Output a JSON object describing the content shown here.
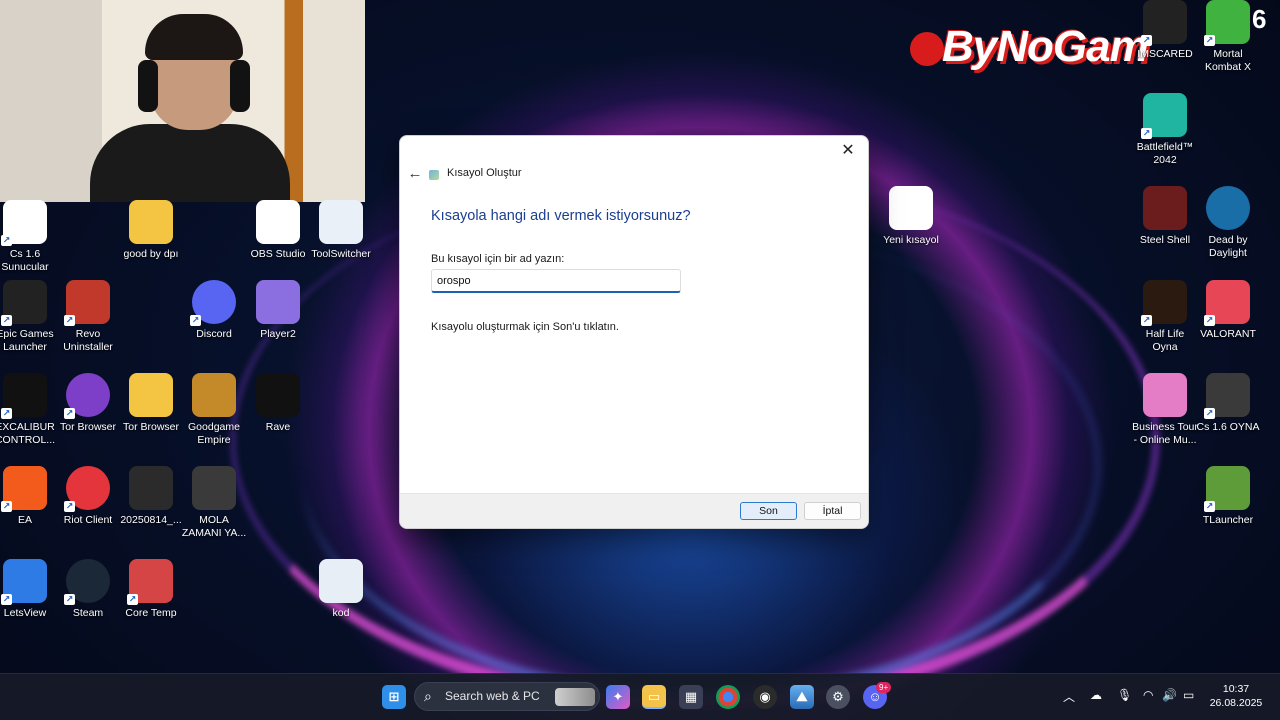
{
  "desktop": {
    "icons": [
      {
        "label": "Cs 1.6\nSunucular",
        "icon": "chrome-icon",
        "color": "#ffffff"
      },
      {
        "label": "good by dpı",
        "icon": "folder-icon",
        "color": "#f4c542"
      },
      {
        "label": "OBS Studio",
        "icon": "document-icon",
        "color": "#ffffff"
      },
      {
        "label": "ToolSwitcher",
        "icon": "document-icon",
        "color": "#e9f0f7"
      },
      {
        "label": "Yeni kısayol",
        "icon": "blank-file-icon",
        "color": "#ffffff"
      },
      {
        "label": "Epic Games\nLauncher",
        "icon": "epic-games-icon",
        "color": "#222222"
      },
      {
        "label": "Revo\nUninstaller",
        "icon": "revo-icon",
        "color": "#c0392b"
      },
      {
        "label": "Discord",
        "icon": "discord-icon",
        "color": "#5865f2"
      },
      {
        "label": "Player2",
        "icon": "player2-icon",
        "color": "#8b6fe0"
      },
      {
        "label": "EXCALIBUR\nCONTROL...",
        "icon": "excalibur-icon",
        "color": "#111111"
      },
      {
        "label": "Tor Browser",
        "icon": "tor-icon",
        "color": "#7d3fc7"
      },
      {
        "label": "Tor Browser",
        "icon": "folder-icon",
        "color": "#f4c542"
      },
      {
        "label": "Goodgame\nEmpire",
        "icon": "crown-icon",
        "color": "#c48a2a"
      },
      {
        "label": "Rave",
        "icon": "rave-icon",
        "color": "#111111"
      },
      {
        "label": "EA",
        "icon": "ea-icon",
        "color": "#f35b1c"
      },
      {
        "label": "Riot Client",
        "icon": "riot-icon",
        "color": "#e4343c"
      },
      {
        "label": "20250814_...",
        "icon": "image-icon",
        "color": "#2b2b2b"
      },
      {
        "label": "MOLA\nZAMANI YA...",
        "icon": "video-icon",
        "color": "#3a3a3a"
      },
      {
        "label": "LetsView",
        "icon": "letsview-icon",
        "color": "#2e7be6"
      },
      {
        "label": "Steam",
        "icon": "steam-icon",
        "color": "#1b2838"
      },
      {
        "label": "Core Temp",
        "icon": "thermometer-icon",
        "color": "#d64545"
      },
      {
        "label": "kod",
        "icon": "text-file-icon",
        "color": "#e8eef5"
      },
      {
        "label": "IMSCARED",
        "icon": "imscared-icon",
        "color": "#222222"
      },
      {
        "label": "Mortal\nKombat X",
        "icon": "mortal-kombat-icon",
        "color": "#3fb23f"
      },
      {
        "label": "Battlefield™\n2042",
        "icon": "battlefield-icon",
        "color": "#1fb5a0"
      },
      {
        "label": "Steel Shell",
        "icon": "steel-shell-icon",
        "color": "#6b1d1d"
      },
      {
        "label": "Dead by\nDaylight",
        "icon": "dead-by-daylight-icon",
        "color": "#1a6ea8"
      },
      {
        "label": "Half Life\nOyna",
        "icon": "half-life-icon",
        "color": "#2a1a10"
      },
      {
        "label": "VALORANT",
        "icon": "valorant-icon",
        "color": "#e64655"
      },
      {
        "label": "Business Tour\n- Online Mu...",
        "icon": "dice-icon",
        "color": "#e57cc6"
      },
      {
        "label": "Cs 1.6 OYNA",
        "icon": "cs-icon",
        "color": "#3a3a3a"
      },
      {
        "label": "TLauncher",
        "icon": "minecraft-icon",
        "color": "#5e9c3a"
      }
    ],
    "brand_text": "ByNoGam",
    "corner_badge": "6"
  },
  "dialog": {
    "title": "Kısayol Oluştur",
    "heading": "Kısayola hangi adı vermek istiyorsunuz?",
    "field_label": "Bu kısayol için bir ad yazın:",
    "field_value": "orospo",
    "hint": "Kısayolu oluşturmak için Son'u tıklatın.",
    "finish_label": "Son",
    "cancel_label": "İptal",
    "close_glyph": "✕",
    "back_glyph": "←"
  },
  "taskbar": {
    "search_placeholder": "Search web & PC",
    "apps": [
      "start-icon",
      "copilot-icon",
      "file-explorer-icon",
      "store-icon",
      "chrome-icon",
      "obs-icon",
      "photos-icon",
      "settings-icon",
      "discord-icon"
    ],
    "notification_count": "9+",
    "time": "10:37",
    "date": "26.08.2025"
  }
}
